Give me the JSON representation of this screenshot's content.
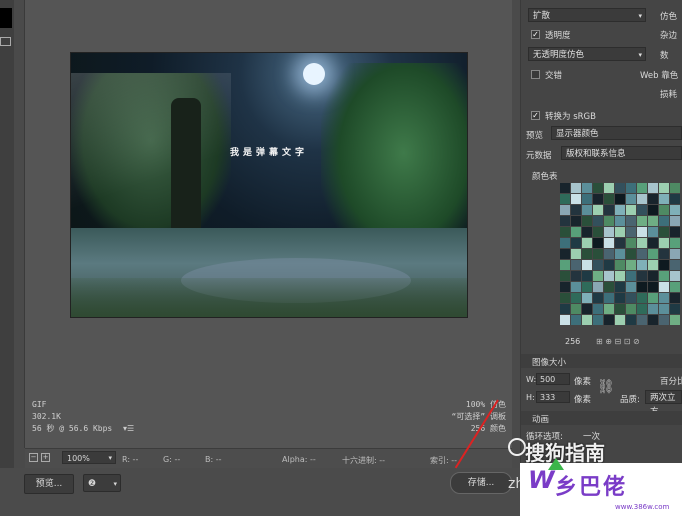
{
  "preview": {
    "overlay_text": "我是弹幕文字",
    "info_left": [
      "GIF",
      "302.1K",
      "56 秒 @ 56.6 Kbps"
    ],
    "info_right": [
      "100% 仿色",
      "“可选择” 调板",
      "256 颜色"
    ]
  },
  "status": {
    "zoom": "100%",
    "r_label": "R: --",
    "g_label": "G: --",
    "b_label": "B: --",
    "alpha_label": "Alpha: --",
    "hex_label": "十六进制: --",
    "index_label": "索引: --"
  },
  "bottom": {
    "preview_label": "预览...",
    "save_label": "存储...",
    "zhi": "zhi"
  },
  "panel": {
    "dither_algorithm": "扩散",
    "dither_label": "仿色",
    "transparency_label": "透明度",
    "transparency_checked": true,
    "matte_label": "杂边",
    "transparency_dither": "无透明度仿色",
    "amount_label": "数",
    "interlaced_label": "交错",
    "web_snap_label": "Web 靠色",
    "lossy_label": "损耗",
    "convert_srgb_label": "转换为 sRGB",
    "convert_srgb_checked": true,
    "preview_label": "预览",
    "preview_value": "显示器颜色",
    "metadata_label": "元数据",
    "metadata_value": "版权和联系信息",
    "color_table_label": "颜色表",
    "color_count": "256",
    "image_size_label": "图像大小",
    "width_label": "W:",
    "width_value": "500",
    "height_label": "H:",
    "height_value": "333",
    "unit": "像素",
    "percent_label": "百分比",
    "quality_label": "品质:",
    "quality_value": "两次立方",
    "animation_label": "动画",
    "loop_label": "循环选项:",
    "loop_value": "一次",
    "top_partial": "仿色"
  },
  "overlays": {
    "sogou": "搜狗指南",
    "logo": "乡巴佬",
    "logo_w": "W",
    "logo_url": "www.386w.com"
  },
  "colors": {
    "panel_bg": "#454545",
    "accent_purple": "#7a3cc7",
    "arrow_green": "#3bb54a"
  }
}
